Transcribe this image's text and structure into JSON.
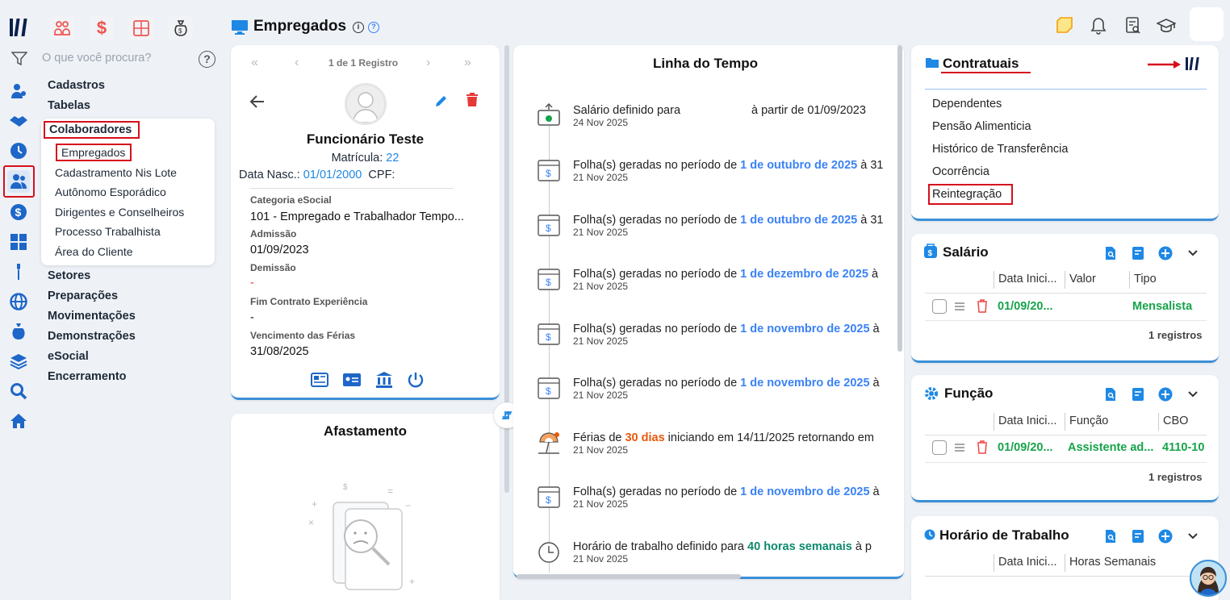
{
  "app": {
    "title": "Empregados"
  },
  "search": {
    "placeholder": "O que você procura?"
  },
  "menu": {
    "items": [
      "Cadastros",
      "Tabelas",
      "Colaboradores",
      "Setores",
      "Preparações",
      "Movimentações",
      "Demonstrações",
      "eSocial",
      "Encerramento"
    ],
    "sub_items": [
      "Empregados",
      "Cadastramento Nis Lote",
      "Autônomo Esporádico",
      "Dirigentes e Conselheiros",
      "Processo Trabalhista",
      "Área do Cliente"
    ]
  },
  "pager": {
    "text": "1 de 1 Registro"
  },
  "employee": {
    "name": "Funcionário Teste",
    "matricula_label": "Matrícula:",
    "matricula": "22",
    "nasc_label": "Data Nasc.:",
    "nasc": "01/01/2000",
    "cpf_label": "CPF:",
    "fields": [
      {
        "label": "Categoria eSocial",
        "value": "101 - Empregado e Trabalhador Tempo..."
      },
      {
        "label": "Admissão",
        "value": "01/09/2023"
      },
      {
        "label": "Demissão",
        "value": "-"
      },
      {
        "label": "Fim Contrato Experiência",
        "value": "-"
      },
      {
        "label": "Vencimento das Férias",
        "value": "31/08/2025"
      }
    ]
  },
  "afastamento": {
    "title": "Afastamento"
  },
  "timeline": {
    "title": "Linha do Tempo",
    "items": [
      {
        "pre": "Salário definido para",
        "hl": "",
        "post": "à partir de 01/09/2023",
        "date": "24 Nov 2025"
      },
      {
        "pre": "Folha(s) geradas no período de ",
        "hl": "1 de outubro de 2025",
        "post": " à 31",
        "date": "21 Nov 2025"
      },
      {
        "pre": "Folha(s) geradas no período de ",
        "hl": "1 de outubro de 2025",
        "post": " à 31",
        "date": "21 Nov 2025"
      },
      {
        "pre": "Folha(s) geradas no período de ",
        "hl": "1 de dezembro de 2025",
        "post": " à",
        "date": "21 Nov 2025"
      },
      {
        "pre": "Folha(s) geradas no período de ",
        "hl": "1 de novembro de 2025",
        "post": " à",
        "date": "21 Nov 2025"
      },
      {
        "pre": "Folha(s) geradas no período de ",
        "hl": "1 de novembro de 2025",
        "post": " à",
        "date": "21 Nov 2025"
      },
      {
        "pre": "Férias de ",
        "hl": "30 dias",
        "post": " iniciando em 14/11/2025 retornando em",
        "date": "21 Nov 2025"
      },
      {
        "pre": "Folha(s) geradas no período de ",
        "hl": "1 de novembro de 2025",
        "post": " à",
        "date": "21 Nov 2025"
      },
      {
        "pre": "Horário de trabalho definido para ",
        "hl": "40 horas semanais",
        "post": " à p",
        "date": "21 Nov 2025"
      }
    ]
  },
  "contratuais": {
    "title": "Contratuais",
    "links": [
      "Dependentes",
      "Pensão Alimenticia",
      "Histórico de Transferência",
      "Ocorrência",
      "Reintegração"
    ]
  },
  "salario": {
    "title": "Salário",
    "headers": [
      "Data Inici...",
      "Valor",
      "Tipo"
    ],
    "row": [
      "01/09/20...",
      "",
      "Mensalista"
    ],
    "count": "1 registros"
  },
  "funcao": {
    "title": "Função",
    "headers": [
      "Data Inici...",
      "Função",
      "CBO"
    ],
    "row": [
      "01/09/20...",
      "Assistente ad...",
      "4110-10"
    ],
    "count": "1 registros"
  },
  "horario": {
    "title": "Horário de Trabalho",
    "headers": [
      "Data Inici...",
      "Horas Semanais"
    ]
  },
  "colors": {
    "accent": "#3b82f6",
    "highlight_box": "#d50f1d",
    "success": "#16a34a",
    "danger": "#ef4444"
  }
}
